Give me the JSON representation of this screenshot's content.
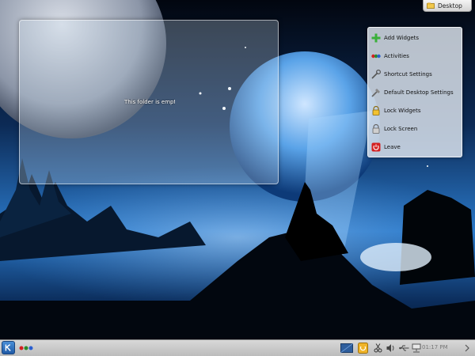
{
  "toolbox": {
    "label": "Desktop",
    "icon": "desktop-toolbox-icon"
  },
  "folder_view": {
    "empty_text": "This folder is empt"
  },
  "context_menu": {
    "items": [
      {
        "label": "Add Widgets",
        "icon": "plus-icon"
      },
      {
        "label": "Activities",
        "icon": "activities-icon"
      },
      {
        "label": "Shortcut Settings",
        "icon": "shortcut-icon"
      },
      {
        "label": "Default Desktop Settings",
        "icon": "settings-wrench-icon"
      },
      {
        "label": "Lock Widgets",
        "icon": "lock-icon"
      },
      {
        "label": "Lock Screen",
        "icon": "lock-screen-icon"
      },
      {
        "label": "Leave",
        "icon": "power-icon"
      }
    ]
  },
  "panel": {
    "clock": "01:17 PM",
    "tray_icons": [
      "show-desktop-icon",
      "updates-icon",
      "klipper-icon",
      "volume-icon",
      "usb-icon",
      "network-icon",
      "expand-tray-icon"
    ]
  },
  "colors": {
    "accent": "#3a7bd5",
    "panel": "#c8c8c8",
    "power": "#d42020"
  }
}
